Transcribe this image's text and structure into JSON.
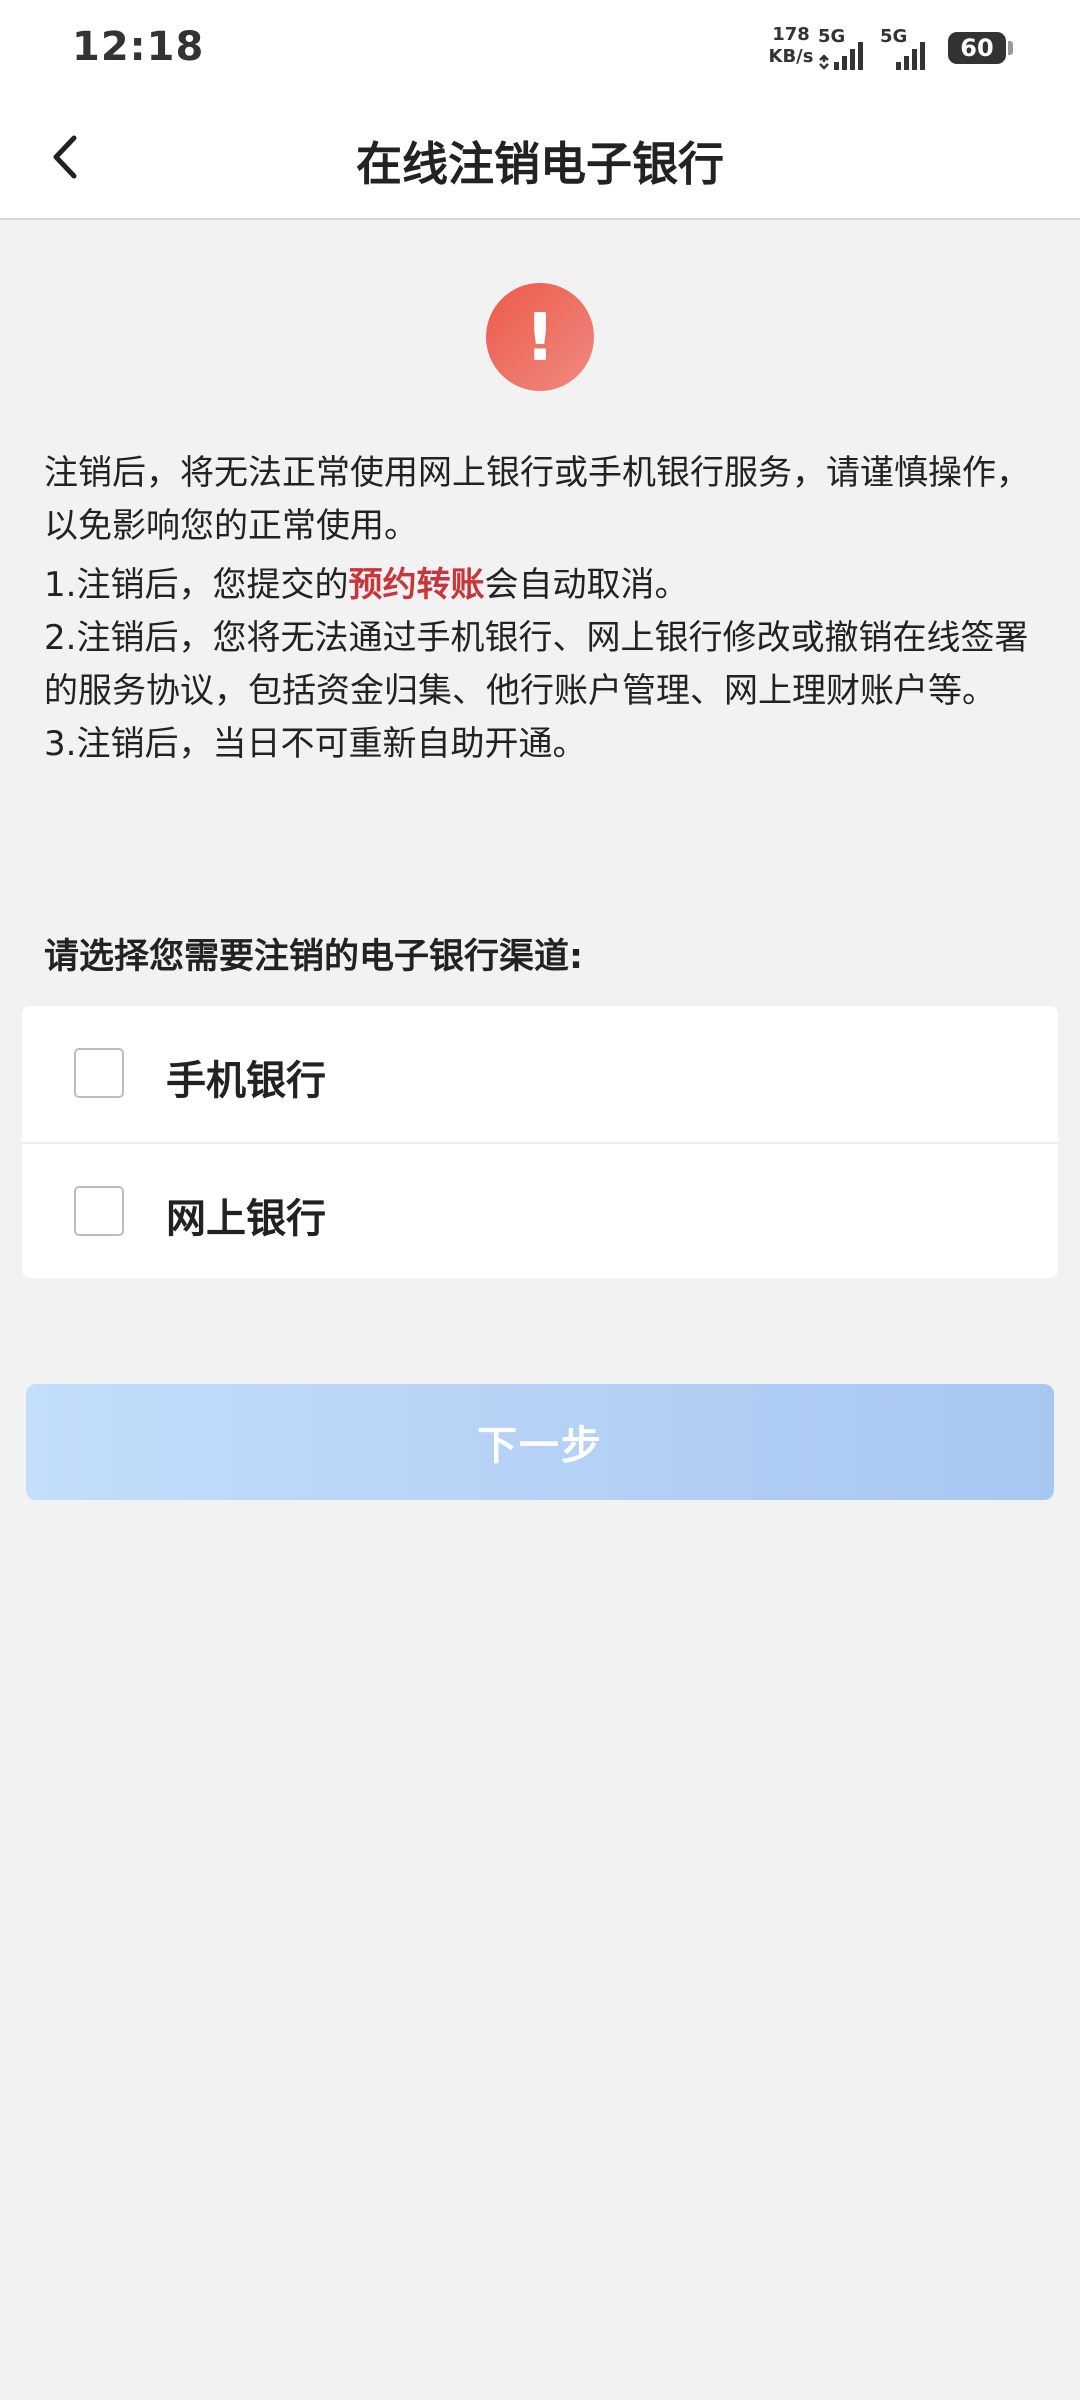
{
  "status_bar": {
    "time": "12:18",
    "net_speed_value": "178",
    "net_speed_unit": "KB/s",
    "sim1_label": "5G",
    "sim2_label": "5G",
    "battery": "60"
  },
  "header": {
    "title": "在线注销电子银行",
    "back_icon": "chevron-left-icon"
  },
  "warning_icon": "exclamation-icon",
  "notice": {
    "intro": "注销后，将无法正常使用网上银行或手机银行服务，请谨慎操作，以免影响您的正常使用。",
    "item1_prefix": "1.注销后，您提交的",
    "item1_highlight": "预约转账",
    "item1_suffix": "会自动取消。",
    "item2": "2.注销后，您将无法通过手机银行、网上银行修改或撤销在线签署的服务协议，包括资金归集、他行账户管理、网上理财账户等。",
    "item3": "3.注销后，当日不可重新自助开通。"
  },
  "section_title": "请选择您需要注销的电子银行渠道:",
  "options": [
    {
      "label": "手机银行",
      "checked": false
    },
    {
      "label": "网上银行",
      "checked": false
    }
  ],
  "next_button": {
    "label": "下一步",
    "enabled": false
  },
  "colors": {
    "highlight": "#c8363d",
    "warning": "#ec5a4a",
    "button_disabled": "#b6d2f5"
  }
}
